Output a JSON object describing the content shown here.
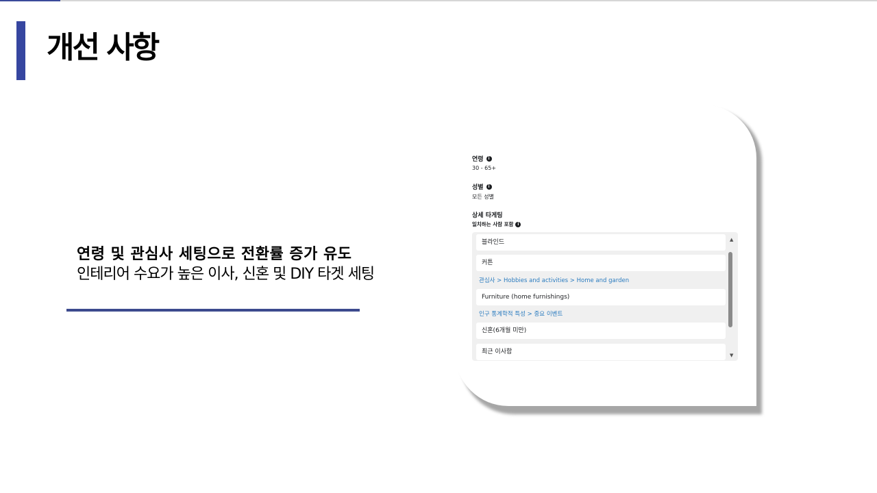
{
  "slide": {
    "title": "개선 사항",
    "headline": "연령 및 관심사 세팅으로 전환률 증가 유도",
    "subline": "인테리어 수요가 높은 이사, 신혼 및 DIY 타겟 세팅"
  },
  "screenshot": {
    "age": {
      "label": "연령",
      "value": "30 - 65+",
      "info_icon": "info-icon"
    },
    "gender": {
      "label": "성별",
      "value": "모든 성별",
      "info_icon": "info-icon"
    },
    "detailed_targeting": {
      "label": "상세 타게팅",
      "include_label": "일치하는 사람 포함",
      "info_icon": "info-icon"
    },
    "targeting_list": {
      "rows": [
        {
          "type": "item",
          "text": "블라인드"
        },
        {
          "type": "item",
          "text": "커튼"
        },
        {
          "type": "path",
          "text": "관심사 > Hobbies and activities > Home and garden"
        },
        {
          "type": "item",
          "text": "Furniture (home furnishings)"
        },
        {
          "type": "path",
          "text": "인구 통계학적 특성 > 중요 이벤트"
        },
        {
          "type": "item",
          "text": "신혼(6개월 미만)"
        },
        {
          "type": "item",
          "text": "최근 이사함"
        }
      ]
    }
  },
  "colors": {
    "accent": "#3646a0",
    "divider": "#3d4a8e",
    "path_text": "#2a7bbf"
  }
}
